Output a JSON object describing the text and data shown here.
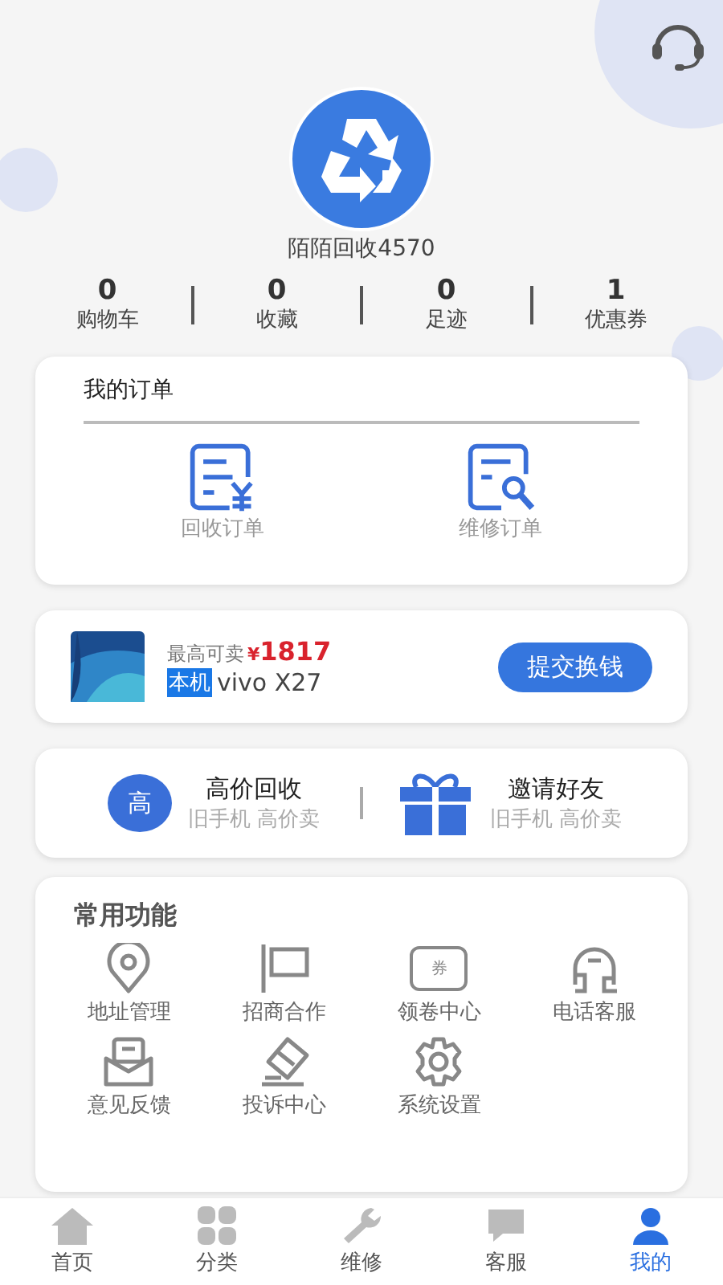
{
  "profile": {
    "name": "陌陌回收4570"
  },
  "stats": [
    {
      "value": "0",
      "label": "购物车"
    },
    {
      "value": "0",
      "label": "收藏"
    },
    {
      "value": "0",
      "label": "足迹"
    },
    {
      "value": "1",
      "label": "优惠券"
    }
  ],
  "orders": {
    "title": "我的订单",
    "items": [
      {
        "kind": "recycle",
        "label": "回收订单"
      },
      {
        "kind": "repair",
        "label": "维修订单"
      }
    ]
  },
  "device": {
    "price_label": "最高可卖",
    "currency": "¥",
    "price": "1817",
    "tag": "本机",
    "model": "vivo X27",
    "button": "提交换钱"
  },
  "promos": [
    {
      "kind": "badge",
      "badge": "高",
      "title": "高价回收",
      "subtitle": "旧手机 高价卖"
    },
    {
      "kind": "gift",
      "title": "邀请好友",
      "subtitle": "旧手机 高价卖"
    }
  ],
  "functions": {
    "title": "常用功能",
    "items": [
      {
        "kind": "pin",
        "label": "地址管理"
      },
      {
        "kind": "flag",
        "label": "招商合作"
      },
      {
        "kind": "ticket",
        "label": "领卷中心",
        "icon_text": "券"
      },
      {
        "kind": "phone",
        "label": "电话客服"
      },
      {
        "kind": "mail",
        "label": "意见反馈"
      },
      {
        "kind": "complain",
        "label": "投诉中心"
      },
      {
        "kind": "gear",
        "label": "系统设置"
      }
    ]
  },
  "tabbar": [
    {
      "kind": "home",
      "label": "首页",
      "selected": false
    },
    {
      "kind": "grid",
      "label": "分类",
      "selected": false
    },
    {
      "kind": "wrench",
      "label": "维修",
      "selected": false
    },
    {
      "kind": "chat",
      "label": "客服",
      "selected": false
    },
    {
      "kind": "user",
      "label": "我的",
      "selected": true
    }
  ]
}
